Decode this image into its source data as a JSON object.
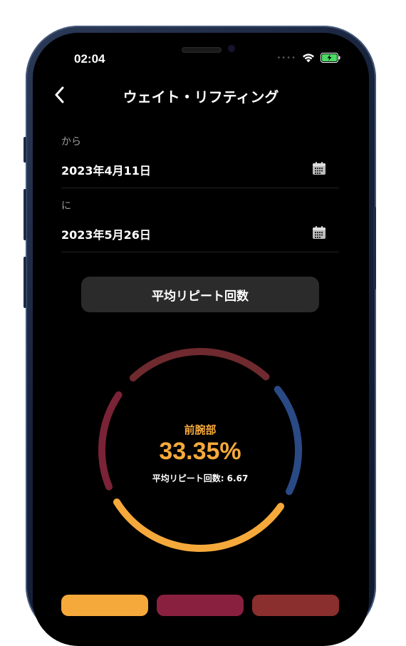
{
  "status_bar": {
    "time": "02:04"
  },
  "header": {
    "title": "ウェイト・リフティング"
  },
  "date_range": {
    "from_label": "から",
    "from_value": "2023年4月11日",
    "to_label": "に",
    "to_value": "2023年5月26日"
  },
  "metric_button": {
    "label": "平均リピート回数"
  },
  "ring_chart": {
    "center_label": "前腕部",
    "center_value": "33.35%",
    "center_subtitle": "平均リピート回数: 6.67",
    "colors": {
      "orange": "#f6a93b",
      "crimson": "#7a2336",
      "dark_red": "#6e2a2e",
      "navy": "#2a4a86"
    }
  },
  "legend": {
    "colors": [
      "#f6a93b",
      "#8a2040",
      "#8b2e2e"
    ]
  }
}
